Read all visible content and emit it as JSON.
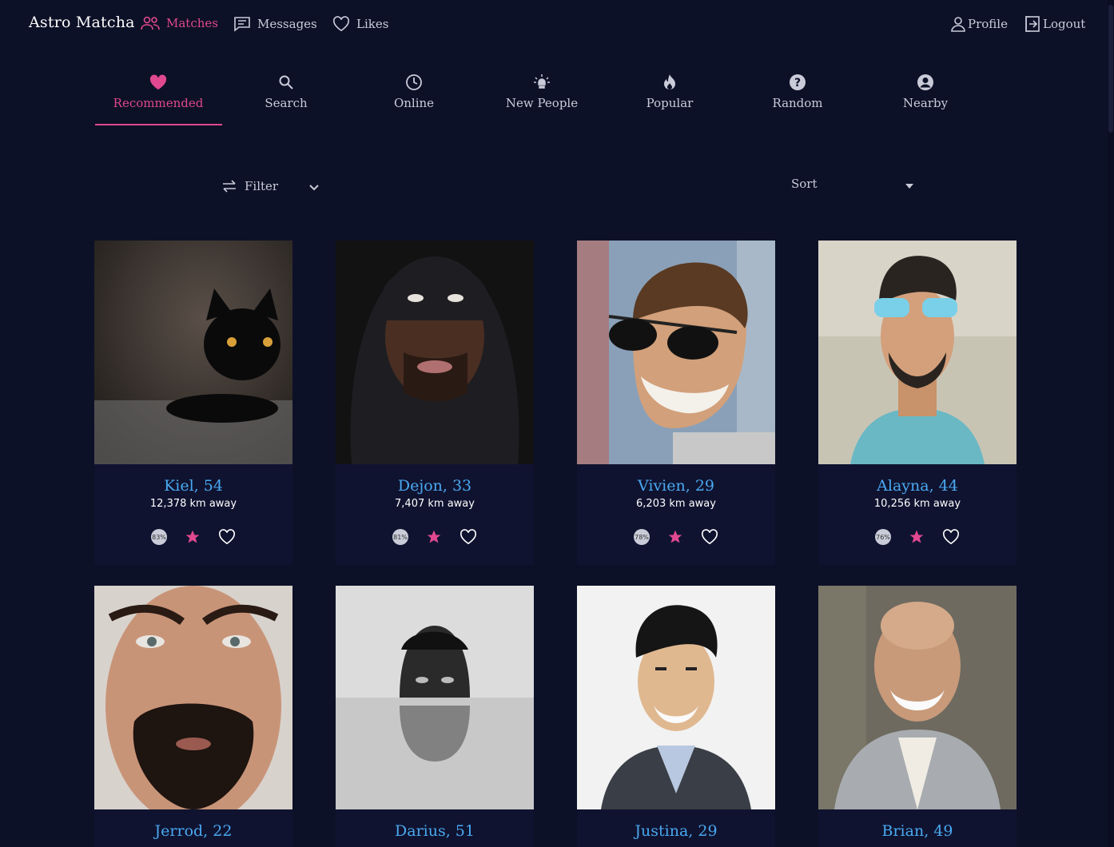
{
  "app": {
    "brand": "Astro Matcha"
  },
  "nav": {
    "matches": "Matches",
    "messages": "Messages",
    "likes": "Likes",
    "profile": "Profile",
    "logout": "Logout"
  },
  "tabs": [
    {
      "label": "Recommended",
      "icon": "heart-icon",
      "active": true
    },
    {
      "label": "Search",
      "icon": "search-icon"
    },
    {
      "label": "Online",
      "icon": "clock-icon"
    },
    {
      "label": "New People",
      "icon": "lightbulb-icon"
    },
    {
      "label": "Popular",
      "icon": "fire-icon"
    },
    {
      "label": "Random",
      "icon": "question-icon"
    },
    {
      "label": "Nearby",
      "icon": "user-circle-icon"
    }
  ],
  "toolbar": {
    "filter_label": "Filter",
    "sort_label": "Sort"
  },
  "colors": {
    "accent": "#e0488f",
    "name": "#4aa8f0",
    "background": "#0d1127"
  },
  "profiles": [
    {
      "name": "Kiel, 54",
      "distance": "12,378 km away",
      "match": "83%"
    },
    {
      "name": "Dejon, 33",
      "distance": "7,407 km away",
      "match": "81%"
    },
    {
      "name": "Vivien, 29",
      "distance": "6,203 km away",
      "match": "78%"
    },
    {
      "name": "Alayna, 44",
      "distance": "10,256 km away",
      "match": "76%"
    },
    {
      "name": "Jerrod, 22"
    },
    {
      "name": "Darius, 51"
    },
    {
      "name": "Justina, 29"
    },
    {
      "name": "Brian, 49"
    }
  ]
}
